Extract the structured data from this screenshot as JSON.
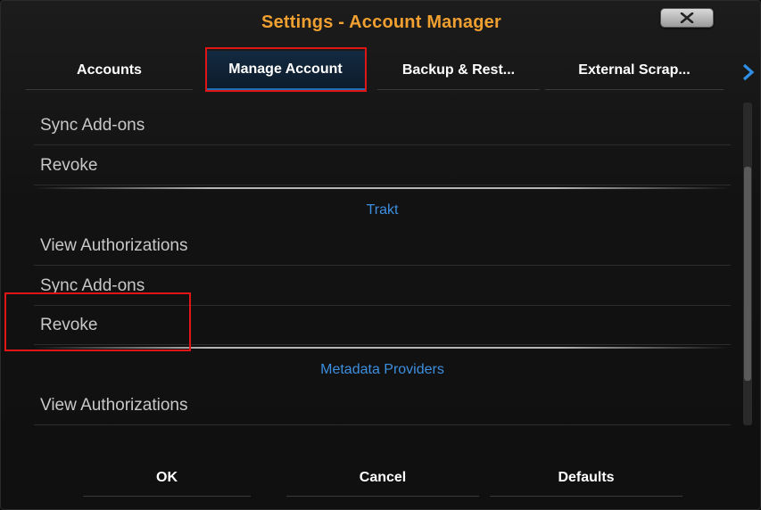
{
  "dialog": {
    "title": "Settings - Account Manager",
    "close_icon": "close-x-icon"
  },
  "tabs": [
    {
      "label": "Accounts",
      "active": false
    },
    {
      "label": "Manage Account",
      "active": true
    },
    {
      "label": "Backup & Rest...",
      "active": false
    },
    {
      "label": "External Scrap...",
      "active": false
    }
  ],
  "tabs_next_icon": "chevron-right-icon",
  "list": {
    "rows": [
      {
        "label": "Sync Add-ons"
      },
      {
        "label": "Revoke"
      },
      {
        "label": "View Authorizations"
      },
      {
        "label": "Sync Add-ons"
      },
      {
        "label": "Revoke"
      },
      {
        "label": "View Authorizations"
      }
    ],
    "sections": [
      {
        "label": "Trakt"
      },
      {
        "label": "Metadata Providers"
      }
    ]
  },
  "footer": {
    "ok_label": "OK",
    "cancel_label": "Cancel",
    "defaults_label": "Defaults"
  },
  "colors": {
    "title": "#f0a030",
    "section_label": "#3d8fe0",
    "highlight_box": "#e01515",
    "active_tab_underline": "#1f6fb5"
  }
}
